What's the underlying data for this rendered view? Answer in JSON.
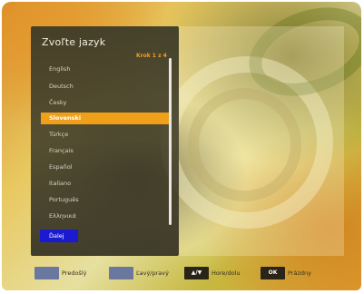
{
  "dialog": {
    "title": "Zvoľte jazyk",
    "step": "Krok 1 z 4",
    "selected_index": 4,
    "next_label": "Ďalej"
  },
  "languages": [
    "English",
    "Deutsch",
    "Česky",
    "Slovenski",
    "Türkçe",
    "Français",
    "Español",
    "Italiano",
    "Português",
    "Ελληνικά"
  ],
  "footer": [
    {
      "key": "",
      "label": "Predošlý"
    },
    {
      "key": "",
      "label": "Ľavý/pravý"
    },
    {
      "key": "▲/▼",
      "label": "Hore/dolu"
    },
    {
      "key": "OK",
      "label": "Prázdny"
    }
  ],
  "colors": {
    "highlight": "#f0a018",
    "next_button": "#1a1ad0",
    "step_text": "#f0a020"
  }
}
